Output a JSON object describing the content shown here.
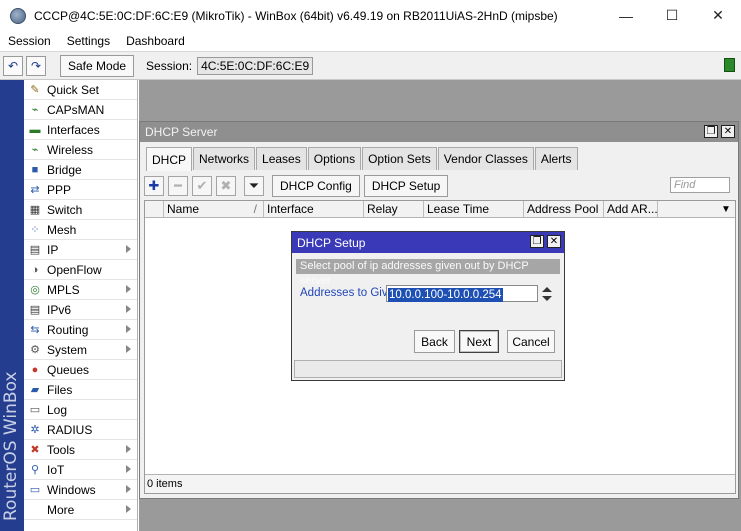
{
  "window": {
    "title": "CCCP@4C:5E:0C:DF:6C:E9 (MikroTik) - WinBox (64bit) v6.49.19 on RB2011UiAS-2HnD (mipsbe)",
    "minimize_glyph": "—",
    "maximize_glyph": "☐",
    "close_glyph": "✕"
  },
  "menu": [
    "Session",
    "Settings",
    "Dashboard"
  ],
  "toolbar": {
    "undo_glyph": "↶",
    "redo_glyph": "↷",
    "safe_mode_label": "Safe Mode",
    "session_label": "Session:",
    "session_value": "4C:5E:0C:DF:6C:E9",
    "status_color": "#2a8a2a"
  },
  "brand": "RouterOS WinBox",
  "sidebar": {
    "items": [
      {
        "label": "Quick Set",
        "icon": "wand-icon",
        "glyph": "✎",
        "color": "#8a6a1a",
        "submenu": false
      },
      {
        "label": "CAPsMAN",
        "icon": "antenna-icon",
        "glyph": "⌁",
        "color": "#2a7a2a",
        "submenu": false
      },
      {
        "label": "Interfaces",
        "icon": "interfaces-icon",
        "glyph": "▬",
        "color": "#2a7a2a",
        "submenu": false
      },
      {
        "label": "Wireless",
        "icon": "wireless-icon",
        "glyph": "⌁",
        "color": "#2a7a2a",
        "submenu": false
      },
      {
        "label": "Bridge",
        "icon": "bridge-icon",
        "glyph": "■",
        "color": "#2a5aa8",
        "submenu": false
      },
      {
        "label": "PPP",
        "icon": "ppp-icon",
        "glyph": "⇄",
        "color": "#2a5aa8",
        "submenu": false
      },
      {
        "label": "Switch",
        "icon": "switch-icon",
        "glyph": "▦",
        "color": "#3a3a3a",
        "submenu": false
      },
      {
        "label": "Mesh",
        "icon": "mesh-icon",
        "glyph": "⁘",
        "color": "#2a5aa8",
        "submenu": false
      },
      {
        "label": "IP",
        "icon": "ip-icon",
        "glyph": "▤",
        "color": "#3a3a3a",
        "submenu": true
      },
      {
        "label": "OpenFlow",
        "icon": "openflow-icon",
        "glyph": "◑",
        "color": "#555555",
        "submenu": false
      },
      {
        "label": "MPLS",
        "icon": "mpls-icon",
        "glyph": "◎",
        "color": "#2a7a2a",
        "submenu": true
      },
      {
        "label": "IPv6",
        "icon": "ipv6-icon",
        "glyph": "▤",
        "color": "#3a3a3a",
        "submenu": true
      },
      {
        "label": "Routing",
        "icon": "routing-icon",
        "glyph": "⇆",
        "color": "#2a5aa8",
        "submenu": true
      },
      {
        "label": "System",
        "icon": "system-icon",
        "glyph": "⚙",
        "color": "#555555",
        "submenu": true
      },
      {
        "label": "Queues",
        "icon": "queues-icon",
        "glyph": "●",
        "color": "#c23a2a",
        "submenu": false
      },
      {
        "label": "Files",
        "icon": "files-icon",
        "glyph": "▰",
        "color": "#2a5aa8",
        "submenu": false
      },
      {
        "label": "Log",
        "icon": "log-icon",
        "glyph": "▭",
        "color": "#555555",
        "submenu": false
      },
      {
        "label": "RADIUS",
        "icon": "radius-icon",
        "glyph": "✲",
        "color": "#2a5aa8",
        "submenu": false
      },
      {
        "label": "Tools",
        "icon": "tools-icon",
        "glyph": "✖",
        "color": "#c23a2a",
        "submenu": true
      },
      {
        "label": "IoT",
        "icon": "iot-icon",
        "glyph": "⚲",
        "color": "#2a5aa8",
        "submenu": true
      },
      {
        "label": "Windows",
        "icon": "windows-icon",
        "glyph": "▭",
        "color": "#2a5aa8",
        "submenu": true
      },
      {
        "label": "More",
        "icon": "",
        "glyph": "",
        "color": "#000000",
        "submenu": true
      }
    ]
  },
  "dhcp_window": {
    "title": "DHCP Server",
    "restore_glyph": "❐",
    "close_glyph": "✕",
    "tabs": [
      "DHCP",
      "Networks",
      "Leases",
      "Options",
      "Option Sets",
      "Vendor Classes",
      "Alerts"
    ],
    "active_tab": "DHCP",
    "add_glyph": "✚",
    "remove_glyph": "━",
    "enable_glyph": "✔",
    "disable_glyph": "✖",
    "filter_glyph": "⏷",
    "config_button": "DHCP Config",
    "setup_button": "DHCP Setup",
    "find_placeholder": "Find",
    "columns": [
      "Name",
      "Interface",
      "Relay",
      "Lease Time",
      "Address Pool",
      "Add AR..."
    ],
    "sort_indicator": "/",
    "menu_glyph": "▼",
    "status": "0 items"
  },
  "setup_dialog": {
    "title": "DHCP Setup",
    "restore_glyph": "❐",
    "close_glyph": "✕",
    "hint": "Select pool of ip addresses given out by DHCP server",
    "field_label": "Addresses to Give Out:",
    "field_value": "10.0.0.100-10.0.0.254",
    "back": "Back",
    "next": "Next",
    "cancel": "Cancel"
  }
}
